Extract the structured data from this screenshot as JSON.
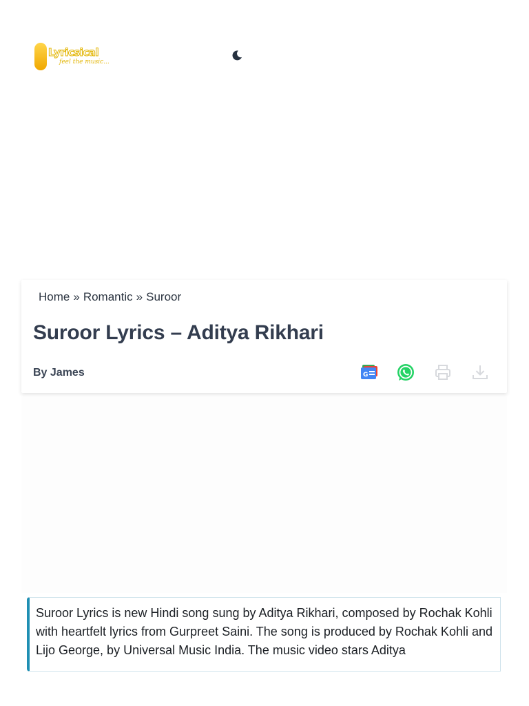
{
  "header": {
    "logo_text": "Lyricsical",
    "logo_tagline": "feel the music...",
    "theme_toggle_icon": "moon-icon"
  },
  "breadcrumb": {
    "items": [
      "Home",
      "Romantic",
      "Suroor"
    ],
    "separator": "»"
  },
  "article": {
    "title": "Suroor Lyrics – Aditya Rikhari",
    "author": "By James",
    "intro": "Suroor Lyrics is new Hindi song sung by Aditya Rikhari, composed by Rochak Kohli with heartfelt lyrics from Gurpreet Saini. The song is produced by Rochak Kohli and Lijo George, by Universal Music India. The music video stars Aditya"
  },
  "share": {
    "icons": [
      "google-news-icon",
      "whatsapp-icon",
      "print-icon",
      "download-icon"
    ]
  },
  "colors": {
    "accent": "#1f8fb3",
    "title": "#333d4f",
    "whatsapp": "#25d366",
    "logo_gold": "#e2b400"
  }
}
